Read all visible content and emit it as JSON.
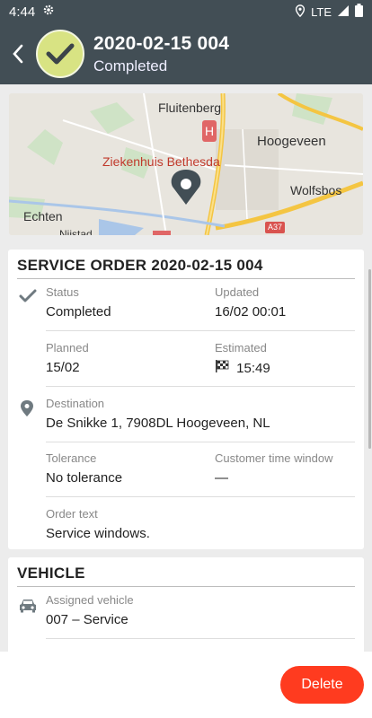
{
  "status_bar": {
    "time": "4:44",
    "network": "LTE"
  },
  "header": {
    "order_id": "2020-02-15 004",
    "status": "Completed"
  },
  "map": {
    "labels": {
      "fluitenberg": "Fluitenberg",
      "hoogeveen": "Hoogeveen",
      "hospital": "Ziekenhuis Bethesda",
      "wolfsbos": "Wolfsbos",
      "echten": "Echten",
      "nijstad": "Nijstad",
      "road": "A37"
    }
  },
  "service_order": {
    "title": "SERVICE ORDER 2020-02-15 004",
    "status_label": "Status",
    "status_value": "Completed",
    "updated_label": "Updated",
    "updated_value": "16/02 00:01",
    "planned_label": "Planned",
    "planned_value": "15/02",
    "estimated_label": "Estimated",
    "estimated_value": "15:49",
    "destination_label": "Destination",
    "destination_value": "De Snikke 1, 7908DL Hoogeveen, NL",
    "tolerance_label": "Tolerance",
    "tolerance_value": "No tolerance",
    "ctw_label": "Customer time window",
    "ctw_value": "—",
    "order_text_label": "Order text",
    "order_text_value": "Service windows."
  },
  "vehicle": {
    "title": "VEHICLE",
    "assigned_label": "Assigned vehicle",
    "assigned_value": "007 – Service"
  },
  "actions": {
    "delete_label": "Delete"
  },
  "colors": {
    "header_bg": "#424e55",
    "badge": "#d8e383",
    "delete": "#ff3b1f"
  }
}
